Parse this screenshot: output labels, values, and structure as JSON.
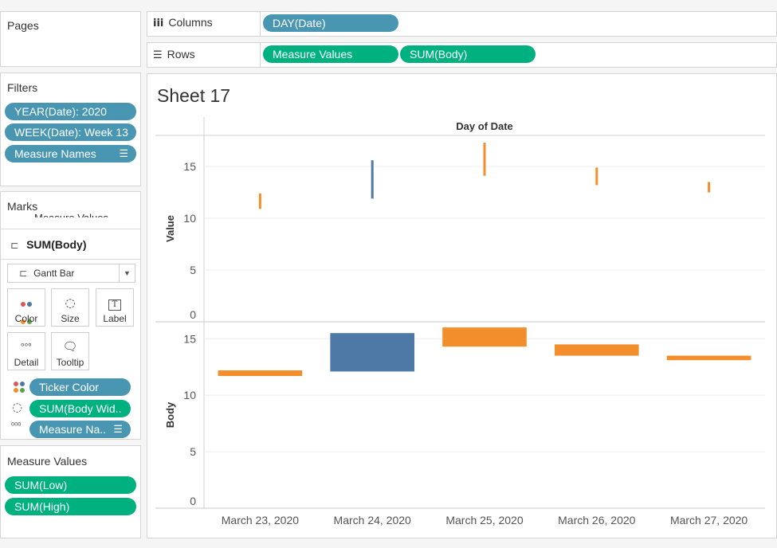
{
  "pages": {
    "title": "Pages"
  },
  "columns": {
    "label": "Columns",
    "pills": [
      "DAY(Date)"
    ]
  },
  "rows": {
    "label": "Rows",
    "pills": [
      "Measure Values",
      "SUM(Body)"
    ]
  },
  "filters": {
    "title": "Filters",
    "items": [
      "YEAR(Date): 2020",
      "WEEK(Date): Week 13",
      "Measure Names"
    ]
  },
  "marks": {
    "title": "Marks",
    "cut_off_label": "Measure Values",
    "measure_label": "SUM(Body)",
    "mark_type": "Gantt Bar",
    "buttons": {
      "color": "Color",
      "size": "Size",
      "label": "Label",
      "detail": "Detail",
      "tooltip": "Tooltip"
    },
    "fields": [
      "Ticker Color",
      "SUM(Body Wid..",
      "Measure Na.."
    ]
  },
  "measure_values": {
    "title": "Measure Values",
    "items": [
      "SUM(Low)",
      "SUM(High)"
    ]
  },
  "sheet": {
    "title": "Sheet 17"
  },
  "colors": {
    "blue": "#4e79a7",
    "orange": "#f28e2b",
    "pill_blue": "#4996b2",
    "pill_green": "#00b180"
  },
  "chart_data": {
    "type": "gantt",
    "column_header": "Day of Date",
    "categories": [
      "March 23, 2020",
      "March 24, 2020",
      "March 25, 2020",
      "March 26, 2020",
      "March 27, 2020"
    ],
    "panes": [
      {
        "ylabel": "Value",
        "ylim": [
          0,
          18
        ],
        "yticks": [
          0,
          5,
          10,
          15
        ],
        "marks": [
          {
            "start": 10.9,
            "end": 12.4,
            "color": "orange"
          },
          {
            "start": 11.9,
            "end": 15.6,
            "color": "blue"
          },
          {
            "start": 14.1,
            "end": 17.3,
            "color": "orange"
          },
          {
            "start": 13.2,
            "end": 14.9,
            "color": "orange"
          },
          {
            "start": 12.5,
            "end": 13.5,
            "color": "orange"
          }
        ]
      },
      {
        "ylabel": "Body",
        "ylim": [
          0,
          16.5
        ],
        "yticks": [
          0,
          5,
          10,
          15
        ],
        "marks": [
          {
            "start": 11.7,
            "end": 12.2,
            "color": "orange"
          },
          {
            "start": 12.1,
            "end": 15.5,
            "color": "blue"
          },
          {
            "start": 14.3,
            "end": 16.0,
            "color": "orange"
          },
          {
            "start": 13.5,
            "end": 14.5,
            "color": "orange"
          },
          {
            "start": 13.1,
            "end": 13.5,
            "color": "orange"
          }
        ]
      }
    ]
  }
}
